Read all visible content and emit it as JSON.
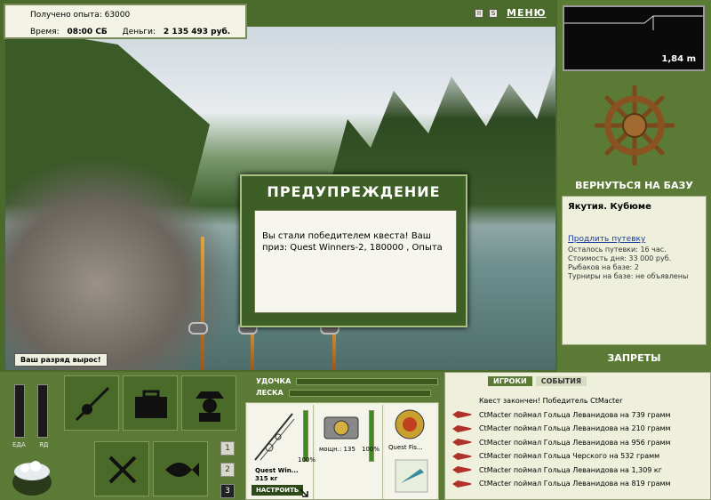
{
  "info": {
    "experience": "Получено опыта: 63000",
    "time_label": "Время:",
    "time_value": "08:00 СБ",
    "money_label": "Деньги:",
    "money_value": "2 135 493 руб."
  },
  "top_icons": {
    "pause": "II",
    "sound": "S",
    "menu": "МЕНЮ"
  },
  "depth": {
    "value": "1,84 m"
  },
  "right_panel": {
    "return_label": "ВЕРНУТЬСЯ НА БАЗУ",
    "location_name": "Якутия. Кубюме",
    "extend_link": "Продлить путевку",
    "lines": [
      "Осталось путевки: 16 час.",
      "Стоимость дня: 33 000 руб.",
      "Рыбаков на базе: 2",
      "Турниры на базе: не объявлены"
    ],
    "bans_label": "ЗАПРЕТЫ"
  },
  "modal": {
    "title": "ПРЕДУПРЕЖДЕНИЕ",
    "message": "Вы стали победителем квеста! Ваш приз: Quest Winners-2, 180000 , Опыта"
  },
  "scene": {
    "rank_badge": "Ваш разряд вырос!"
  },
  "meters": {
    "food_label": "ЕДА",
    "poison_label": "ЯД"
  },
  "page_numbers": [
    "1",
    "2",
    "3"
  ],
  "tackle": {
    "float_label": "УДОЧКА",
    "line_label": "ЛЕСКА",
    "rod_name": "Quest Win...",
    "rod_weight": "315 кг",
    "rod_pct": "100%",
    "reel_name": "мощн.: 135",
    "reel_pct": "100%",
    "lure_name": "Quest Fis...",
    "setup_label": "НАСТРОИТЬ",
    "rod_fill": 1.0,
    "reel_fill": 1.0
  },
  "events": {
    "tabs": [
      "ИГРОКИ",
      "СОБЫТИЯ"
    ],
    "header": "Квест закончен! Победитель CtMacter",
    "items": [
      "CtMacter поймал Гольца Леванидова на 739 грамм",
      "CtMacter поймал Гольца Леванидова на 210 грамм",
      "CtMacter поймал Гольца Леванидова на 956 грамм",
      "CtMacter поймал Гольца Черского на 532 грамм",
      "CtMacter поймал Гольца Леванидова на 1,309 кг",
      "CtMacter поймал Гольца Леванидова на 819 грамм"
    ]
  },
  "colors": {
    "panel_green": "#5a7a36",
    "panel_light": "#eef0dc",
    "accent_green": "#3e8a24",
    "fish_red": "#b0302a"
  }
}
